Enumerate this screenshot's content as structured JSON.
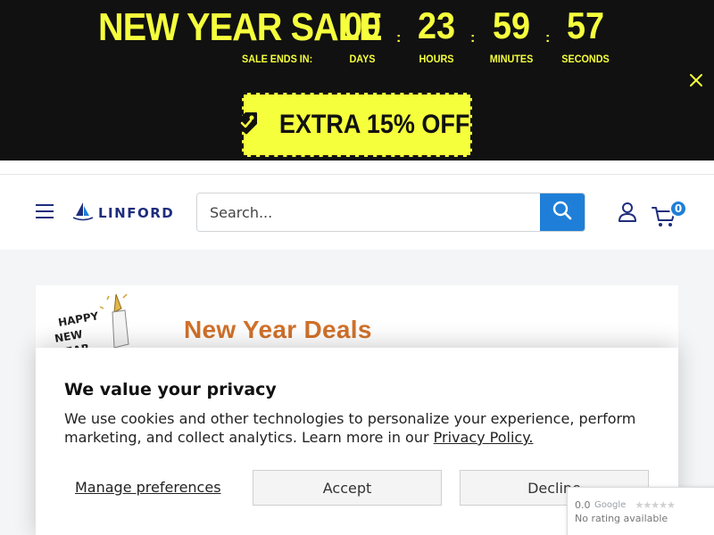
{
  "promo": {
    "title": "NEW YEAR SALE",
    "ends_label": "SALE ENDS IN:",
    "countdown": [
      {
        "value": "00",
        "label": "DAYS"
      },
      {
        "value": "23",
        "label": "HOURS"
      },
      {
        "value": "59",
        "label": "MINUTES"
      },
      {
        "value": "57",
        "label": "SECONDS"
      }
    ],
    "separator": ":",
    "offer_text": "EXTRA 15% OFF",
    "offer_icon": "tag-icon",
    "close_icon": "close-icon",
    "accent_color": "#f5ff3c",
    "background_color": "#111111"
  },
  "header": {
    "logo_text": "LINFORD",
    "menu_icon": "hamburger-icon",
    "search": {
      "placeholder": "Search...",
      "value": "",
      "button_icon": "search-icon"
    },
    "account_icon": "user-icon",
    "cart_icon": "cart-icon",
    "cart_count": "0",
    "brand_color": "#1e2d7d",
    "accent_color": "#1f7fd8"
  },
  "banner": {
    "badge_text": "HAPPY NEW YEAR",
    "title": "New Year Deals",
    "title_color": "#d0712b"
  },
  "cookie": {
    "title": "We value your privacy",
    "description": "We use cookies and other technologies to personalize your experience, perform marketing, and collect analytics. Learn more in our ",
    "policy_link": "Privacy Policy.",
    "manage_label": "Manage preferences",
    "accept_label": "Accept",
    "decline_label": "Decline"
  },
  "google_widget": {
    "score": "0.0",
    "stars": "★★★★★",
    "subtitle": "No rating available"
  }
}
